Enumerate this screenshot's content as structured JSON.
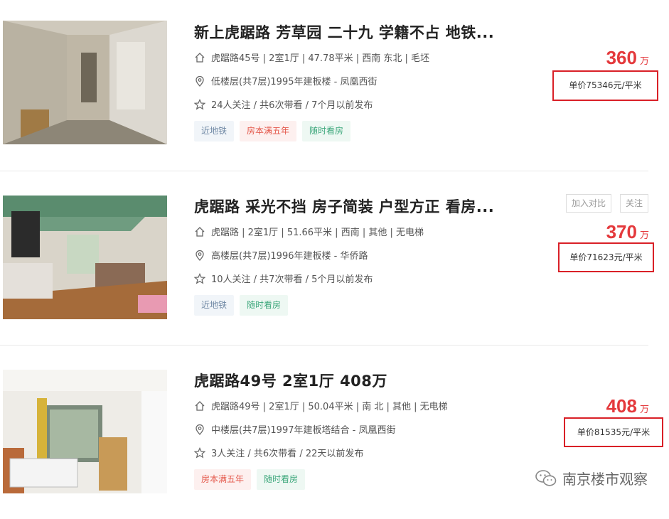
{
  "listings": [
    {
      "title": "新上虎踞路 芳草园 二十九 学籍不占 地铁...",
      "house_info": "虎踞路45号 | 2室1厅 | 47.78平米 | 西南 东北 | 毛坯",
      "position_info": "低楼层(共7层)1995年建板楼 - 凤凰西街",
      "follow_info": "24人关注 / 共6次带看 / 7个月以前发布",
      "tags": [
        "近地铁",
        "房本满五年",
        "随时看房"
      ],
      "total_price": "360",
      "price_unit": "万",
      "unit_price": "单价75346元/平米"
    },
    {
      "title": "虎踞路 采光不挡 房子简装 户型方正 看房...",
      "house_info": "虎踞路 | 2室1厅 | 51.66平米 | 西南 | 其他 | 无电梯",
      "position_info": "高楼层(共7层)1996年建板楼 - 华侨路",
      "follow_info": "10人关注 / 共7次带看 / 5个月以前发布",
      "tags": [
        "近地铁",
        "随时看房"
      ],
      "total_price": "370",
      "price_unit": "万",
      "unit_price": "单价71623元/平米",
      "compare_label": "加入对比",
      "follow_label": "关注"
    },
    {
      "title": "虎踞路49号 2室1厅 408万",
      "house_info": "虎踞路49号 | 2室1厅 | 50.04平米 | 南 北 | 其他 | 无电梯",
      "position_info": "中楼层(共7层)1997年建板塔结合 - 凤凰西街",
      "follow_info": "3人关注 / 共6次带看 / 22天以前发布",
      "tags": [
        "房本满五年",
        "随时看房"
      ],
      "total_price": "408",
      "price_unit": "万",
      "unit_price": "单价81535元/平米"
    }
  ],
  "watermark": "南京楼市观察",
  "colors": {
    "price": "#e4393c",
    "highlight_box": "#d92027"
  },
  "icons": {
    "house": "house-icon",
    "location": "location-pin-icon",
    "star": "star-icon",
    "wechat": "wechat-icon"
  }
}
